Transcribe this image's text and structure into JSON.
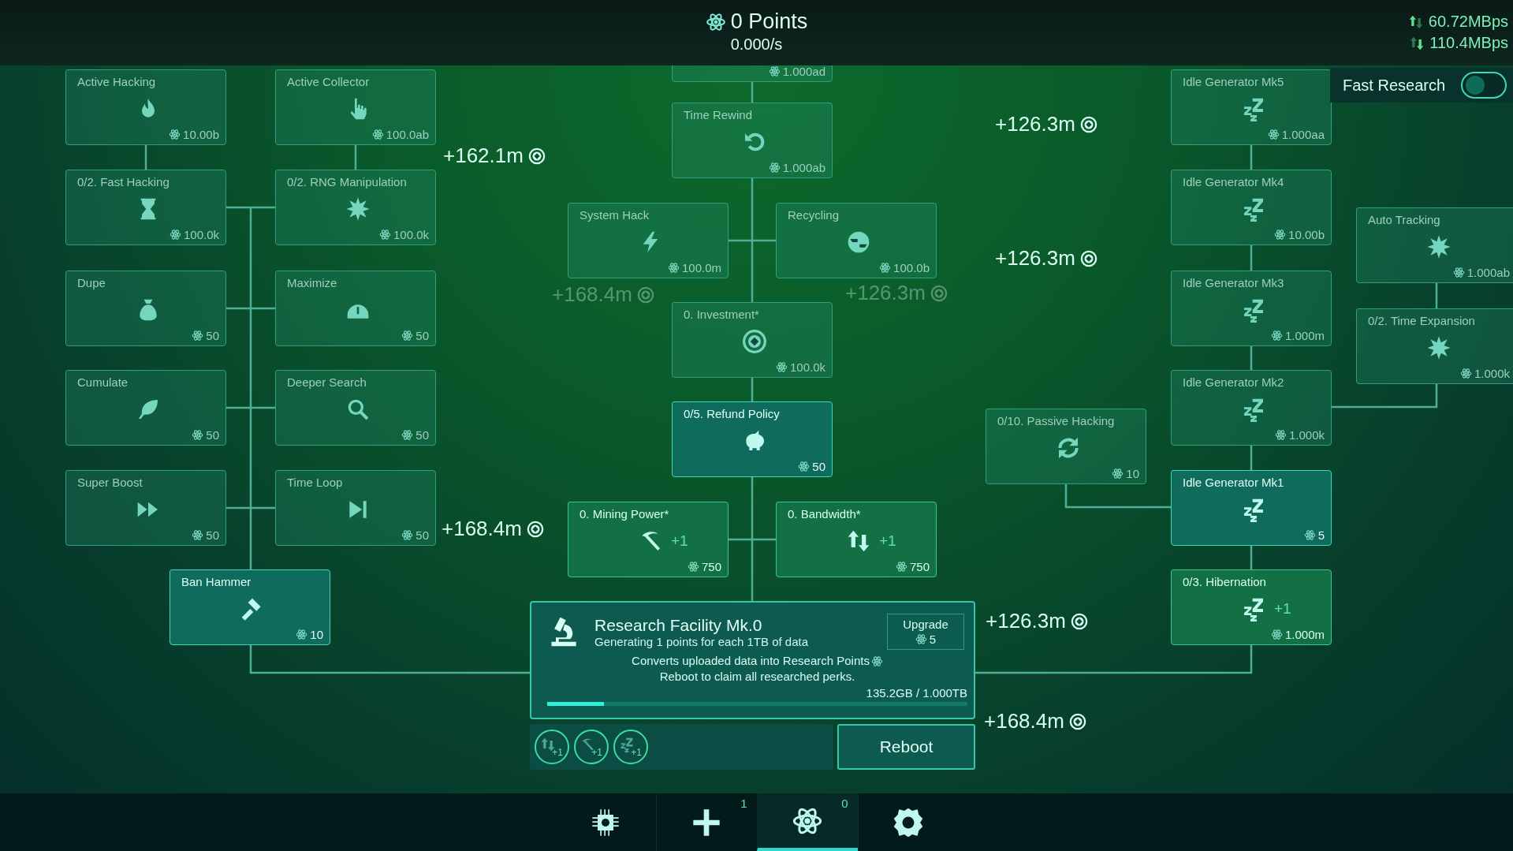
{
  "header": {
    "points": "0 Points",
    "rate": "0.000/s",
    "upload": "60.72MBps",
    "download": "110.4MBps"
  },
  "fast_research": {
    "label": "Fast Research",
    "on": false
  },
  "nodes": [
    {
      "title": "Active Hacking",
      "cost": "10.00b",
      "kind": "perk",
      "available": false
    },
    {
      "title": "Active Collector",
      "cost": "100.0ab",
      "kind": "perk",
      "available": false
    },
    {
      "cost": "1.000ad",
      "kind": "perk",
      "available": false
    },
    {
      "title": "Idle Generator Mk5",
      "cost": "1.000aa",
      "kind": "perk",
      "available": false
    },
    {
      "title": "Time Rewind",
      "cost": "1.000ab",
      "kind": "perk",
      "available": false
    },
    {
      "title": "0/2. Fast Hacking",
      "cost": "100.0k",
      "kind": "perk",
      "available": false
    },
    {
      "title": "0/2. RNG Manipulation",
      "cost": "100.0k",
      "kind": "perk",
      "available": false
    },
    {
      "title": "Idle Generator Mk4",
      "cost": "10.00b",
      "kind": "perk",
      "available": false
    },
    {
      "title": "System Hack",
      "cost": "100.0m",
      "kind": "perk",
      "available": false
    },
    {
      "title": "Recycling",
      "cost": "100.0b",
      "kind": "perk",
      "available": false
    },
    {
      "title": "Auto Tracking",
      "cost": "1.000ab",
      "kind": "perk",
      "available": false
    },
    {
      "title": "Dupe",
      "cost": "50",
      "kind": "perk",
      "available": false
    },
    {
      "title": "Maximize",
      "cost": "50",
      "kind": "perk",
      "available": false
    },
    {
      "title": "Idle Generator Mk3",
      "cost": "1.000m",
      "kind": "perk",
      "available": false
    },
    {
      "title": "0. Investment*",
      "cost": "100.0k",
      "kind": "perk",
      "available": false
    },
    {
      "title": "0/2. Time Expansion",
      "cost": "1.000k",
      "kind": "perk",
      "available": false
    },
    {
      "title": "Cumulate",
      "cost": "50",
      "kind": "perk",
      "available": false
    },
    {
      "title": "Deeper Search",
      "cost": "50",
      "kind": "perk",
      "available": false
    },
    {
      "title": "0/5. Refund Policy",
      "cost": "50",
      "kind": "perk",
      "available": true
    },
    {
      "title": "Idle Generator Mk2",
      "cost": "1.000k",
      "kind": "perk",
      "available": false
    },
    {
      "title": "0/10. Passive Hacking",
      "cost": "10",
      "kind": "perk",
      "available": false
    },
    {
      "title": "Super Boost",
      "cost": "50",
      "kind": "perk",
      "available": false
    },
    {
      "title": "Time Loop",
      "cost": "50",
      "kind": "perk",
      "available": false
    },
    {
      "title": "0. Mining Power*",
      "cost": "750",
      "kind": "boost",
      "available": true,
      "bonus": "+1"
    },
    {
      "title": "0. Bandwidth*",
      "cost": "750",
      "kind": "boost",
      "available": true,
      "bonus": "+1"
    },
    {
      "title": "Idle Generator Mk1",
      "cost": "5",
      "kind": "perk",
      "available": true
    },
    {
      "title": "Ban Hammer",
      "cost": "10",
      "kind": "perk",
      "available": true
    },
    {
      "title": "0/3. Hibernation",
      "cost": "1.000m",
      "kind": "boost",
      "available": true,
      "bonus": "+1"
    }
  ],
  "popups": [
    {
      "text": "+162.1m",
      "faded": false
    },
    {
      "text": "+126.3m",
      "faded": false
    },
    {
      "text": "+126.3m",
      "faded": false
    },
    {
      "text": "+126.3m",
      "faded": true
    },
    {
      "text": "+168.4m",
      "faded": false
    },
    {
      "text": "+168.4m",
      "faded": true
    },
    {
      "text": "+126.3m",
      "faded": false
    },
    {
      "text": "+168.4m",
      "faded": false
    }
  ],
  "research": {
    "title": "Research Facility Mk.0",
    "subtitle": "Generating 1 points for each 1TB of data",
    "description": [
      "Converts uploaded data into Research Points",
      "Reboot to claim all researched perks."
    ],
    "upgrade": {
      "label": "Upgrade",
      "cost": "5"
    },
    "storage": "135.2GB / 1.000TB",
    "level": 0.135
  },
  "boosts": [
    {
      "label": "+1"
    },
    {
      "label": "+1"
    },
    {
      "label": "+1"
    }
  ],
  "reboot": "Reboot",
  "nav": [
    {
      "selected": false
    },
    {
      "badge": "1",
      "selected": false
    },
    {
      "badge": "0",
      "selected": true
    },
    {
      "selected": false
    }
  ]
}
